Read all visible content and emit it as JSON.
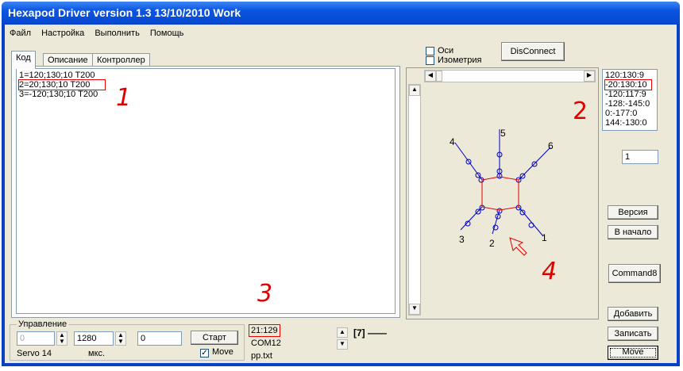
{
  "window": {
    "title": "Hexapod Driver version 1.3   13/10/2010 Work"
  },
  "menu": [
    "Файл",
    "Настройка",
    "Выполнить",
    "Помощь"
  ],
  "tabs": [
    "Код",
    "Описание",
    "Контроллер"
  ],
  "code_lines": [
    "1=120;130;10 T200",
    "2=20;130;10 T200",
    "3=-120;130;10 T200"
  ],
  "options": {
    "axes": "Оси",
    "isometry": "Изометрия",
    "disconnect": "DisConnect"
  },
  "coords_list": [
    "120:130:9",
    "-20:130:10",
    "-120:117:9",
    "-128:-145:0",
    "0:-177:0",
    "144:-130:0"
  ],
  "index_field": "1",
  "buttons": {
    "version": "Версия",
    "home": "В начало",
    "command8": "Command8",
    "add": "Добавить",
    "write": "Записать",
    "move": "Move"
  },
  "control": {
    "group": "Управление",
    "servo_value": "0",
    "pulse_value": "1280",
    "third_value": "0",
    "start": "Старт",
    "move_check": "Move",
    "servo_label": "Servo 14",
    "unit_label": "мкс."
  },
  "status": {
    "position": "21:129",
    "port": "COM12",
    "file": "pp.txt",
    "counter": "[7] ——"
  },
  "legs": [
    "1",
    "2",
    "3",
    "4",
    "5",
    "6"
  ],
  "annotations": [
    "1",
    "2",
    "3",
    "4"
  ]
}
